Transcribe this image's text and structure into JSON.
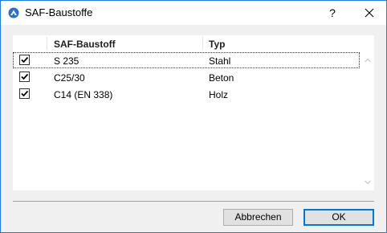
{
  "window": {
    "title": "SAF-Baustoffe",
    "help_glyph": "?",
    "accent_color": "#2b79d6"
  },
  "list": {
    "columns": [
      "SAF-Baustoff",
      "Typ"
    ],
    "rows": [
      {
        "checked": true,
        "name": "S 235",
        "type": "Stahl"
      },
      {
        "checked": true,
        "name": "C25/30",
        "type": "Beton"
      },
      {
        "checked": true,
        "name": "C14 (EN 338)",
        "type": "Holz"
      }
    ]
  },
  "buttons": {
    "cancel": "Abbrechen",
    "ok": "OK"
  },
  "icons": {
    "app": "archicad-app-icon",
    "close": "close-icon",
    "checkbox": "checkmark-icon",
    "scroll_up": "chevron-up-icon",
    "scroll_down": "chevron-down-icon"
  }
}
